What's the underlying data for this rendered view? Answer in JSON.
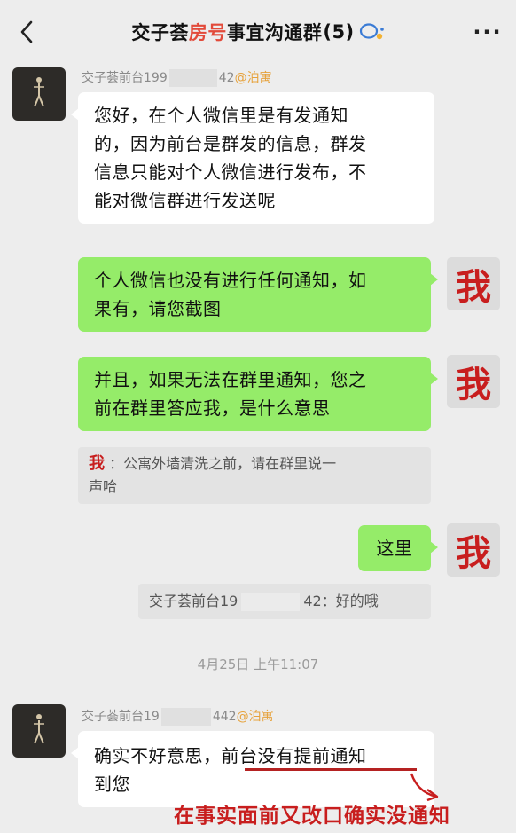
{
  "header": {
    "title_part1": "交子荟",
    "title_highlight": "房号",
    "title_part2": "事宜沟通群",
    "member_count": "(5)",
    "more_label": "···"
  },
  "messages": {
    "m1": {
      "sender_prefix": "交子荟前台199",
      "sender_suffix": "42",
      "sender_tag": "@泊寓",
      "lines": [
        "您好，在个人微信里是有发通知",
        "的，因为前台是群发的信息，群发",
        "信息只能对个人微信进行发布，不",
        "能对微信群进行发送呢"
      ]
    },
    "m2": {
      "lines": [
        "个人微信也没有进行任何通知，如",
        "果有，请您截图"
      ],
      "me_label": "我"
    },
    "m3": {
      "lines": [
        "并且，如果无法在群里通知，您之",
        "前在群里答应我，是什么意思"
      ],
      "me_label": "我"
    },
    "quote1": {
      "name": "我",
      "sep": " ：",
      "text1": "公寓外墙清洗之前，请在群里说一",
      "text2": "声哈"
    },
    "m4": {
      "text": "这里",
      "me_label": "我"
    },
    "quote2": {
      "prefix": "交子荟前台19",
      "suffix": "42：",
      "text": "好的哦"
    },
    "timestamp": "4月25日 上午11:07",
    "m5": {
      "sender_prefix": "交子荟前台19",
      "sender_suffix": "442",
      "sender_tag": "@泊寓",
      "line1_part1": "确实不好意思，",
      "line1_part2": "前台没有提前通知",
      "line2": "到您"
    }
  },
  "annotation": "在事实面前又改口确实没通知",
  "colors": {
    "green_bubble": "#95ec69",
    "white_bubble": "#ffffff",
    "accent_red": "#c81e1e",
    "tag_orange": "#e6a23c",
    "background": "#ededed"
  }
}
